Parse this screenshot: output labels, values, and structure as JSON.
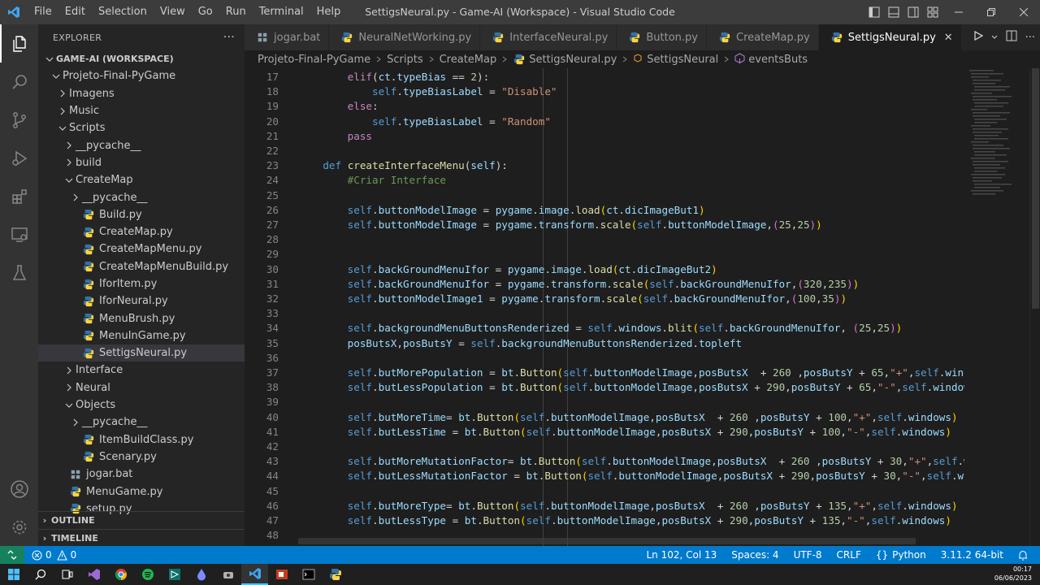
{
  "window": {
    "title": "SettigsNeural.py - Game-AI (Workspace) - Visual Studio Code",
    "menu": [
      "File",
      "Edit",
      "Selection",
      "View",
      "Go",
      "Run",
      "Terminal",
      "Help"
    ]
  },
  "sidebar": {
    "header": "EXPLORER",
    "more": "···",
    "tree": [
      {
        "label": "GAME-AI (WORKSPACE)",
        "depth": 0,
        "chev": "v",
        "icon": "",
        "bold": true
      },
      {
        "label": "Projeto-Final-PyGame",
        "depth": 1,
        "chev": "v",
        "icon": ""
      },
      {
        "label": "Imagens",
        "depth": 2,
        "chev": ">",
        "icon": ""
      },
      {
        "label": "Music",
        "depth": 2,
        "chev": ">",
        "icon": ""
      },
      {
        "label": "Scripts",
        "depth": 2,
        "chev": "v",
        "icon": ""
      },
      {
        "label": "__pycache__",
        "depth": 3,
        "chev": ">",
        "icon": ""
      },
      {
        "label": "build",
        "depth": 3,
        "chev": ">",
        "icon": ""
      },
      {
        "label": "CreateMap",
        "depth": 3,
        "chev": "v",
        "icon": ""
      },
      {
        "label": "__pycache__",
        "depth": 4,
        "chev": ">",
        "icon": ""
      },
      {
        "label": "Build.py",
        "depth": 4,
        "chev": "",
        "icon": "python"
      },
      {
        "label": "CreateMap.py",
        "depth": 4,
        "chev": "",
        "icon": "python"
      },
      {
        "label": "CreateMapMenu.py",
        "depth": 4,
        "chev": "",
        "icon": "python"
      },
      {
        "label": "CreateMapMenuBuild.py",
        "depth": 4,
        "chev": "",
        "icon": "python"
      },
      {
        "label": "IforItem.py",
        "depth": 4,
        "chev": "",
        "icon": "python"
      },
      {
        "label": "IforNeural.py",
        "depth": 4,
        "chev": "",
        "icon": "python"
      },
      {
        "label": "MenuBrush.py",
        "depth": 4,
        "chev": "",
        "icon": "python"
      },
      {
        "label": "MenuInGame.py",
        "depth": 4,
        "chev": "",
        "icon": "python"
      },
      {
        "label": "SettigsNeural.py",
        "depth": 4,
        "chev": "",
        "icon": "python",
        "selected": true
      },
      {
        "label": "Interface",
        "depth": 3,
        "chev": ">",
        "icon": ""
      },
      {
        "label": "Neural",
        "depth": 3,
        "chev": ">",
        "icon": ""
      },
      {
        "label": "Objects",
        "depth": 3,
        "chev": "v",
        "icon": ""
      },
      {
        "label": "__pycache__",
        "depth": 4,
        "chev": ">",
        "icon": ""
      },
      {
        "label": "ItemBuildClass.py",
        "depth": 4,
        "chev": "",
        "icon": "python"
      },
      {
        "label": "Scenary.py",
        "depth": 4,
        "chev": "",
        "icon": "python"
      },
      {
        "label": "jogar.bat",
        "depth": 2,
        "chev": "",
        "icon": "bat"
      },
      {
        "label": "MenuGame.py",
        "depth": 2,
        "chev": "",
        "icon": "python"
      },
      {
        "label": "setup.py",
        "depth": 2,
        "chev": "",
        "icon": "python"
      }
    ],
    "outline": "OUTLINE",
    "timeline": "TIMELINE"
  },
  "tabs": [
    {
      "label": "jogar.bat",
      "icon": "bat"
    },
    {
      "label": "NeuralNetWorking.py",
      "icon": "python"
    },
    {
      "label": "InterfaceNeural.py",
      "icon": "python"
    },
    {
      "label": "Button.py",
      "icon": "python"
    },
    {
      "label": "CreateMap.py",
      "icon": "python"
    },
    {
      "label": "SettigsNeural.py",
      "icon": "python",
      "active": true,
      "close": "✕"
    }
  ],
  "breadcrumb": [
    "Projeto-Final-PyGame",
    "Scripts",
    "CreateMap",
    "SettigsNeural.py",
    "SettigsNeural",
    "eventsButs"
  ],
  "code_lines": [
    {
      "n": "17",
      "html": "        <span class='k'>elif</span>(<span class='v'>ct</span>.<span class='v'>typeBias</span> == <span class='n'>2</span>):"
    },
    {
      "n": "18",
      "html": "            <span class='sl'>self</span>.<span class='v'>typeBiasLabel</span> = <span class='s'>\"Disable\"</span>"
    },
    {
      "n": "19",
      "html": "        <span class='k'>else</span>:"
    },
    {
      "n": "20",
      "html": "            <span class='sl'>self</span>.<span class='v'>typeBiasLabel</span> = <span class='s'>\"Random\"</span>"
    },
    {
      "n": "21",
      "html": "        <span class='k'>pass</span>"
    },
    {
      "n": "22",
      "html": ""
    },
    {
      "n": "23",
      "html": "    <span class='kd'>def</span> <span class='fn'>createInterfaceMenu</span>(<span class='v'>self</span>):"
    },
    {
      "n": "24",
      "html": "        <span class='c'>#Criar Interface</span>"
    },
    {
      "n": "25",
      "html": ""
    },
    {
      "n": "26",
      "html": "        <span class='sl'>self</span>.<span class='v'>buttonModelImage</span> = <span class='v'>pygame</span>.<span class='v'>image</span>.<span class='fn'>load</span><span class='p'>(</span><span class='v'>ct</span>.<span class='v'>dicImageBut1</span><span class='p'>)</span>"
    },
    {
      "n": "27",
      "html": "        <span class='sl'>self</span>.<span class='v'>buttonModelImage</span> = <span class='v'>pygame</span>.<span class='v'>transform</span>.<span class='fn'>scale</span><span class='p'>(</span><span class='sl'>self</span>.<span class='v'>buttonModelImage</span>,<span class='c' style='color:#da70d6'>(</span><span class='n'>25</span>,<span class='n'>25</span><span class='c' style='color:#da70d6'>)</span><span class='p'>)</span>"
    },
    {
      "n": "28",
      "html": ""
    },
    {
      "n": "29",
      "html": ""
    },
    {
      "n": "30",
      "html": "        <span class='sl'>self</span>.<span class='v'>backGroundMenuIfor</span> = <span class='v'>pygame</span>.<span class='v'>image</span>.<span class='fn'>load</span><span class='p'>(</span><span class='v'>ct</span>.<span class='v'>dicImageBut2</span><span class='p'>)</span>"
    },
    {
      "n": "31",
      "html": "        <span class='sl'>self</span>.<span class='v'>backGroundMenuIfor</span> = <span class='v'>pygame</span>.<span class='v'>transform</span>.<span class='fn'>scale</span><span class='p'>(</span><span class='sl'>self</span>.<span class='v'>backGroundMenuIfor</span>,<span class='c' style='color:#da70d6'>(</span><span class='n'>320</span>,<span class='n'>235</span><span class='c' style='color:#da70d6'>)</span><span class='p'>)</span>"
    },
    {
      "n": "32",
      "html": "        <span class='sl'>self</span>.<span class='v'>buttonModelImage1</span> = <span class='v'>pygame</span>.<span class='v'>transform</span>.<span class='fn'>scale</span><span class='p'>(</span><span class='sl'>self</span>.<span class='v'>backGroundMenuIfor</span>,<span class='c' style='color:#da70d6'>(</span><span class='n'>100</span>,<span class='n'>35</span><span class='c' style='color:#da70d6'>)</span><span class='p'>)</span>"
    },
    {
      "n": "33",
      "html": ""
    },
    {
      "n": "34",
      "html": "        <span class='sl'>self</span>.<span class='v'>backgroundMenuButtonsRenderized</span> = <span class='sl'>self</span>.<span class='v'>windows</span>.<span class='fn'>blit</span><span class='p'>(</span><span class='sl'>self</span>.<span class='v'>backGroundMenuIfor</span>, <span class='c' style='color:#da70d6'>(</span><span class='n'>25</span>,<span class='n'>25</span><span class='c' style='color:#da70d6'>)</span><span class='p'>)</span>"
    },
    {
      "n": "35",
      "html": "        <span class='v'>posButsX</span>,<span class='v'>posButsY</span> = <span class='sl'>self</span>.<span class='v'>backgroundMenuButtonsRenderized</span>.<span class='v'>topleft</span>"
    },
    {
      "n": "36",
      "html": ""
    },
    {
      "n": "37",
      "html": "        <span class='sl'>self</span>.<span class='v'>butMorePopulation</span> = <span class='v'>bt</span>.<span class='fn'>Button</span><span class='p'>(</span><span class='sl'>self</span>.<span class='v'>buttonModelImage</span>,<span class='v'>posButsX</span>  + <span class='n'>260</span> ,<span class='v'>posButsY</span> + <span class='n'>65</span>,<span class='s'>\"+\"</span>,<span class='sl'>self</span>.<span class='v'>window</span>"
    },
    {
      "n": "38",
      "html": "        <span class='sl'>self</span>.<span class='v'>butLessPopulation</span> = <span class='v'>bt</span>.<span class='fn'>Button</span><span class='p'>(</span><span class='sl'>self</span>.<span class='v'>buttonModelImage</span>,<span class='v'>posButsX</span> + <span class='n'>290</span>,<span class='v'>posButsY</span> + <span class='n'>65</span>,<span class='s'>\"-\"</span>,<span class='sl'>self</span>.<span class='v'>windows</span><span class='p'>)</span>"
    },
    {
      "n": "39",
      "html": ""
    },
    {
      "n": "40",
      "html": "        <span class='sl'>self</span>.<span class='v'>butMoreTime</span>= <span class='v'>bt</span>.<span class='fn'>Button</span><span class='p'>(</span><span class='sl'>self</span>.<span class='v'>buttonModelImage</span>,<span class='v'>posButsX</span>  + <span class='n'>260</span> ,<span class='v'>posButsY</span> + <span class='n'>100</span>,<span class='s'>\"+\"</span>,<span class='sl'>self</span>.<span class='v'>windows</span><span class='p'>)</span>"
    },
    {
      "n": "41",
      "html": "        <span class='sl'>self</span>.<span class='v'>butLessTime</span> = <span class='v'>bt</span>.<span class='fn'>Button</span><span class='p'>(</span><span class='sl'>self</span>.<span class='v'>buttonModelImage</span>,<span class='v'>posButsX</span> + <span class='n'>290</span>,<span class='v'>posButsY</span> + <span class='n'>100</span>,<span class='s'>\"-\"</span>,<span class='sl'>self</span>.<span class='v'>windows</span><span class='p'>)</span>"
    },
    {
      "n": "42",
      "html": ""
    },
    {
      "n": "43",
      "html": "        <span class='sl'>self</span>.<span class='v'>butMoreMutationFactor</span>= <span class='v'>bt</span>.<span class='fn'>Button</span><span class='p'>(</span><span class='sl'>self</span>.<span class='v'>buttonModelImage</span>,<span class='v'>posButsX</span>  + <span class='n'>260</span> ,<span class='v'>posButsY</span> + <span class='n'>30</span>,<span class='s'>\"+\"</span>,<span class='sl'>self</span>.<span class='v'>win</span>"
    },
    {
      "n": "44",
      "html": "        <span class='sl'>self</span>.<span class='v'>butLessMutationFactor</span> = <span class='v'>bt</span>.<span class='fn'>Button</span><span class='p'>(</span><span class='sl'>self</span>.<span class='v'>buttonModelImage</span>,<span class='v'>posButsX</span> + <span class='n'>290</span>,<span class='v'>posButsY</span> + <span class='n'>30</span>,<span class='s'>\"-\"</span>,<span class='sl'>self</span>.<span class='v'>wind</span>"
    },
    {
      "n": "45",
      "html": ""
    },
    {
      "n": "46",
      "html": "        <span class='sl'>self</span>.<span class='v'>butMoreType</span>= <span class='v'>bt</span>.<span class='fn'>Button</span><span class='p'>(</span><span class='sl'>self</span>.<span class='v'>buttonModelImage</span>,<span class='v'>posButsX</span>  + <span class='n'>260</span> ,<span class='v'>posButsY</span> + <span class='n'>135</span>,<span class='s'>\"+\"</span>,<span class='sl'>self</span>.<span class='v'>windows</span><span class='p'>)</span>"
    },
    {
      "n": "47",
      "html": "        <span class='sl'>self</span>.<span class='v'>butLessType</span> = <span class='v'>bt</span>.<span class='fn'>Button</span><span class='p'>(</span><span class='sl'>self</span>.<span class='v'>buttonModelImage</span>,<span class='v'>posButsX</span> + <span class='n'>290</span>,<span class='v'>posButsY</span> + <span class='n'>135</span>,<span class='s'>\"-\"</span>,<span class='sl'>self</span>.<span class='v'>windows</span><span class='p'>)</span>"
    },
    {
      "n": "48",
      "html": ""
    }
  ],
  "statusbar": {
    "problems": "0",
    "warnings": "0",
    "position": "Ln 102, Col 13",
    "spaces": "Spaces: 4",
    "encoding": "UTF-8",
    "eol": "CRLF",
    "language": "Python",
    "interpreter": "3.11.2 64-bit"
  },
  "taskbar": {
    "time": "00:17",
    "date": "06/06/2023"
  },
  "colors": {
    "accent": "#007acc",
    "remote": "#16825d",
    "python_icon": "#3572a5",
    "python_icon_yellow": "#ffd43b",
    "bat_icon": "#8ca0ad"
  }
}
